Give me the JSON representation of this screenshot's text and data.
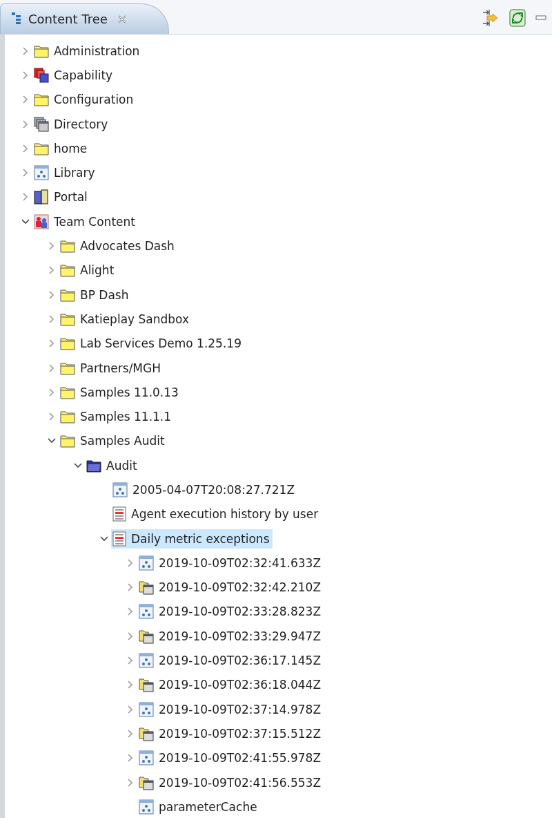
{
  "tab": {
    "title": "Content Tree"
  },
  "tree": [
    {
      "label": "Administration",
      "kind": "folder",
      "expanded": false,
      "selected": false
    },
    {
      "label": "Capability",
      "kind": "capability",
      "expanded": false,
      "selected": false
    },
    {
      "label": "Configuration",
      "kind": "folder",
      "expanded": false,
      "selected": false
    },
    {
      "label": "Directory",
      "kind": "directory",
      "expanded": false,
      "selected": false
    },
    {
      "label": "home",
      "kind": "folder",
      "expanded": false,
      "selected": false
    },
    {
      "label": "Library",
      "kind": "library",
      "expanded": false,
      "selected": false
    },
    {
      "label": "Portal",
      "kind": "portal",
      "expanded": false,
      "selected": false
    },
    {
      "label": "Team Content",
      "kind": "team",
      "expanded": true,
      "selected": false,
      "children": [
        {
          "label": "Advocates Dash",
          "kind": "folder",
          "expanded": false,
          "selected": false
        },
        {
          "label": "Alight",
          "kind": "folder",
          "expanded": false,
          "selected": false
        },
        {
          "label": "BP Dash",
          "kind": "folder",
          "expanded": false,
          "selected": false
        },
        {
          "label": "Katieplay Sandbox",
          "kind": "folder",
          "expanded": false,
          "selected": false
        },
        {
          "label": "Lab Services Demo 1.25.19",
          "kind": "folder",
          "expanded": false,
          "selected": false
        },
        {
          "label": "Partners/MGH",
          "kind": "folder",
          "expanded": false,
          "selected": false
        },
        {
          "label": "Samples 11.0.13",
          "kind": "folder",
          "expanded": false,
          "selected": false
        },
        {
          "label": "Samples 11.1.1",
          "kind": "folder",
          "expanded": false,
          "selected": false
        },
        {
          "label": "Samples Audit",
          "kind": "folder",
          "expanded": true,
          "selected": false,
          "children": [
            {
              "label": "Audit",
              "kind": "package",
              "expanded": true,
              "selected": false,
              "children": [
                {
                  "label": "2005-04-07T20:08:27.721Z",
                  "kind": "library",
                  "selected": false
                },
                {
                  "label": "Agent execution history by user",
                  "kind": "report",
                  "selected": false
                },
                {
                  "label": "Daily metric exceptions",
                  "kind": "report",
                  "expanded": true,
                  "selected": true,
                  "children": [
                    {
                      "label": "2019-10-09T02:32:41.633Z",
                      "kind": "library",
                      "expanded": false,
                      "selected": false
                    },
                    {
                      "label": "2019-10-09T02:32:42.210Z",
                      "kind": "job",
                      "expanded": false,
                      "selected": false
                    },
                    {
                      "label": "2019-10-09T02:33:28.823Z",
                      "kind": "library",
                      "expanded": false,
                      "selected": false
                    },
                    {
                      "label": "2019-10-09T02:33:29.947Z",
                      "kind": "job",
                      "expanded": false,
                      "selected": false
                    },
                    {
                      "label": "2019-10-09T02:36:17.145Z",
                      "kind": "library",
                      "expanded": false,
                      "selected": false
                    },
                    {
                      "label": "2019-10-09T02:36:18.044Z",
                      "kind": "job",
                      "expanded": false,
                      "selected": false
                    },
                    {
                      "label": "2019-10-09T02:37:14.978Z",
                      "kind": "library",
                      "expanded": false,
                      "selected": false
                    },
                    {
                      "label": "2019-10-09T02:37:15.512Z",
                      "kind": "job",
                      "expanded": false,
                      "selected": false
                    },
                    {
                      "label": "2019-10-09T02:41:55.978Z",
                      "kind": "library",
                      "expanded": false,
                      "selected": false
                    },
                    {
                      "label": "2019-10-09T02:41:56.553Z",
                      "kind": "job",
                      "expanded": false,
                      "selected": false
                    },
                    {
                      "label": "parameterCache",
                      "kind": "library",
                      "selected": false
                    }
                  ]
                }
              ]
            }
          ]
        }
      ]
    }
  ]
}
